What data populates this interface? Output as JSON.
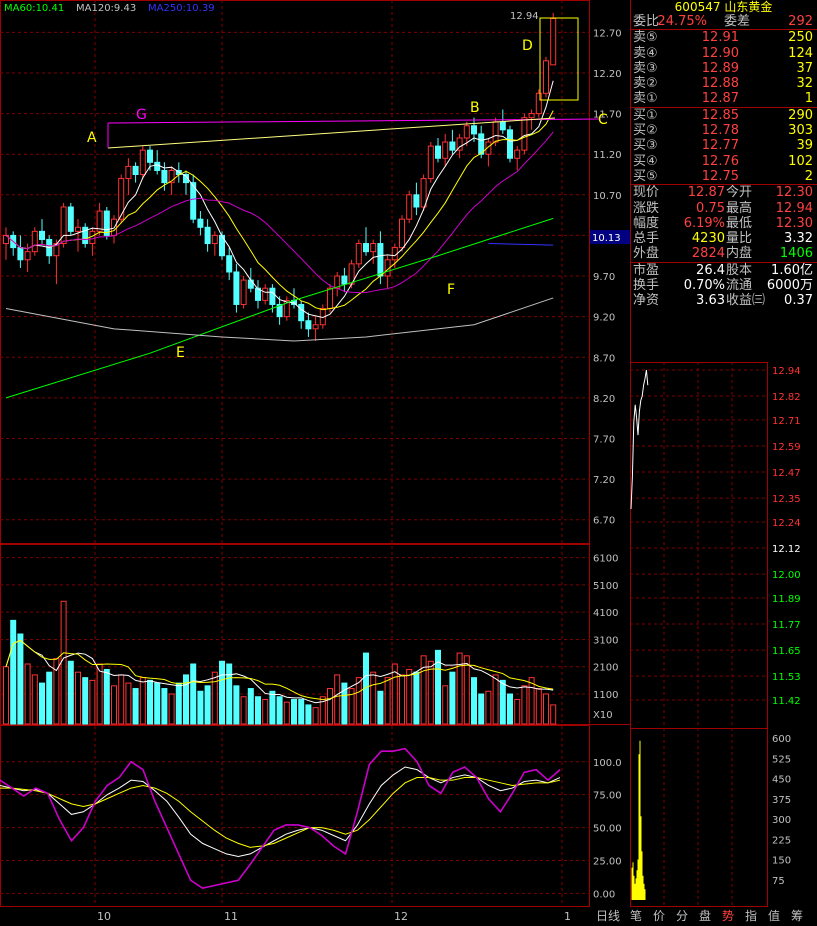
{
  "stock": {
    "code": "600547",
    "name": "山东黄金"
  },
  "ma_legend": [
    {
      "label": "MA60:10.41",
      "color": "#00ff00"
    },
    {
      "label": "MA120:9.43",
      "color": "#c0c0c0"
    },
    {
      "label": "MA250:10.39",
      "color": "#3333ff"
    }
  ],
  "annotations": {
    "A": "A",
    "B": "B",
    "C": "C",
    "D": "D",
    "E": "E",
    "F": "F",
    "G": "G",
    "peak": "12.94"
  },
  "current_price_tag": "10.13",
  "volume_unit": "X10",
  "quote": {
    "wei_bi_label": "委比",
    "wei_bi": "24.75%",
    "wei_cha_label": "委差",
    "wei_cha": "292",
    "sell": [
      {
        "label": "卖⑤",
        "price": "12.91",
        "vol": "250"
      },
      {
        "label": "卖④",
        "price": "12.90",
        "vol": "124"
      },
      {
        "label": "卖③",
        "price": "12.89",
        "vol": "37"
      },
      {
        "label": "卖②",
        "price": "12.88",
        "vol": "32"
      },
      {
        "label": "卖①",
        "price": "12.87",
        "vol": "1"
      }
    ],
    "buy": [
      {
        "label": "买①",
        "price": "12.85",
        "vol": "290"
      },
      {
        "label": "买②",
        "price": "12.78",
        "vol": "303"
      },
      {
        "label": "买③",
        "price": "12.77",
        "vol": "39"
      },
      {
        "label": "买④",
        "price": "12.76",
        "vol": "102"
      },
      {
        "label": "买⑤",
        "price": "12.75",
        "vol": "2"
      }
    ],
    "stats": [
      {
        "l1": "现价",
        "v1": "12.87",
        "c1": "#ff4040",
        "l2": "今开",
        "v2": "12.30",
        "c2": "#ff4040"
      },
      {
        "l1": "涨跌",
        "v1": "0.75",
        "c1": "#ff4040",
        "l2": "最高",
        "v2": "12.94",
        "c2": "#ff4040"
      },
      {
        "l1": "幅度",
        "v1": "6.19%",
        "c1": "#ff4040",
        "l2": "最低",
        "v2": "12.30",
        "c2": "#ff4040"
      },
      {
        "l1": "总手",
        "v1": "4230",
        "c1": "#ffff00",
        "l2": "量比",
        "v2": "3.32",
        "c2": "#ffffff"
      },
      {
        "l1": "外盘",
        "v1": "2824",
        "c1": "#ff4040",
        "l2": "内盘",
        "v2": "1406",
        "c2": "#00ff00"
      }
    ],
    "fundamentals": [
      {
        "l1": "市盈",
        "v1": "26.4",
        "l2": "股本",
        "v2": "1.60亿"
      },
      {
        "l1": "换手",
        "v1": "0.70%",
        "l2": "流通",
        "v2": "6000万"
      },
      {
        "l1": "净资",
        "v1": "3.63",
        "l2": "收益㈢",
        "v2": "0.37"
      }
    ]
  },
  "tabs": [
    "日线",
    "笔",
    "价",
    "分",
    "盘",
    "势",
    "指",
    "值",
    "筹"
  ],
  "chart_data": [
    {
      "type": "candlestick",
      "y_ticks": [
        "12.70",
        "12.20",
        "11.70",
        "11.20",
        "10.70",
        "10.20",
        "9.70",
        "9.20",
        "8.70",
        "8.20",
        "7.70",
        "7.20",
        "6.70"
      ],
      "ylim": [
        6.45,
        13.0
      ],
      "x_ticks": [
        "10",
        "11",
        "12",
        "1"
      ],
      "candles": [
        [
          10.1,
          10.3,
          9.9,
          10.2
        ],
        [
          10.2,
          10.25,
          9.95,
          10.05
        ],
        [
          10.05,
          10.2,
          9.8,
          9.9
        ],
        [
          9.9,
          10.1,
          9.75,
          10.0
        ],
        [
          10.0,
          10.3,
          9.95,
          10.25
        ],
        [
          10.25,
          10.4,
          10.1,
          10.15
        ],
        [
          10.15,
          10.2,
          9.85,
          9.95
        ],
        [
          9.95,
          10.15,
          9.6,
          10.1
        ],
        [
          10.1,
          10.6,
          10.05,
          10.55
        ],
        [
          10.55,
          10.6,
          10.2,
          10.25
        ],
        [
          10.25,
          10.4,
          10.0,
          10.3
        ],
        [
          10.3,
          10.35,
          10.05,
          10.1
        ],
        [
          10.1,
          10.3,
          9.95,
          10.25
        ],
        [
          10.25,
          10.6,
          10.2,
          10.5
        ],
        [
          10.5,
          10.55,
          10.15,
          10.2
        ],
        [
          10.2,
          10.45,
          10.1,
          10.4
        ],
        [
          10.4,
          10.95,
          10.35,
          10.9
        ],
        [
          10.9,
          11.15,
          10.7,
          11.05
        ],
        [
          11.05,
          11.1,
          10.85,
          10.95
        ],
        [
          10.95,
          11.3,
          10.9,
          11.25
        ],
        [
          11.25,
          11.3,
          11.0,
          11.1
        ],
        [
          11.1,
          11.25,
          10.95,
          11.0
        ],
        [
          11.0,
          11.1,
          10.75,
          10.85
        ],
        [
          10.85,
          11.05,
          10.7,
          11.0
        ],
        [
          11.0,
          11.1,
          10.85,
          10.95
        ],
        [
          10.95,
          11.0,
          10.7,
          10.85
        ],
        [
          10.85,
          10.95,
          10.35,
          10.4
        ],
        [
          10.4,
          10.5,
          10.2,
          10.3
        ],
        [
          10.3,
          10.4,
          10.0,
          10.1
        ],
        [
          10.1,
          10.25,
          9.95,
          10.2
        ],
        [
          10.2,
          10.25,
          9.9,
          9.95
        ],
        [
          9.95,
          10.05,
          9.65,
          9.75
        ],
        [
          9.75,
          9.85,
          9.25,
          9.35
        ],
        [
          9.35,
          9.7,
          9.3,
          9.65
        ],
        [
          9.65,
          9.8,
          9.5,
          9.55
        ],
        [
          9.55,
          9.65,
          9.3,
          9.4
        ],
        [
          9.4,
          9.6,
          9.35,
          9.55
        ],
        [
          9.55,
          9.6,
          9.25,
          9.35
        ],
        [
          9.35,
          9.45,
          9.1,
          9.2
        ],
        [
          9.2,
          9.45,
          9.15,
          9.4
        ],
        [
          9.4,
          9.55,
          9.3,
          9.35
        ],
        [
          9.35,
          9.4,
          9.05,
          9.15
        ],
        [
          9.15,
          9.25,
          8.95,
          9.05
        ],
        [
          9.05,
          9.2,
          8.9,
          9.1
        ],
        [
          9.1,
          9.35,
          9.05,
          9.3
        ],
        [
          9.3,
          9.6,
          9.25,
          9.55
        ],
        [
          9.55,
          9.75,
          9.45,
          9.7
        ],
        [
          9.7,
          9.8,
          9.5,
          9.6
        ],
        [
          9.6,
          9.9,
          9.55,
          9.85
        ],
        [
          9.85,
          10.15,
          9.8,
          10.1
        ],
        [
          10.1,
          10.3,
          9.95,
          10.0
        ],
        [
          10.0,
          10.15,
          9.85,
          10.1
        ],
        [
          10.1,
          10.25,
          9.6,
          9.7
        ],
        [
          9.7,
          9.95,
          9.55,
          9.9
        ],
        [
          9.9,
          10.1,
          9.8,
          10.05
        ],
        [
          10.05,
          10.45,
          10.0,
          10.4
        ],
        [
          10.4,
          10.75,
          10.35,
          10.7
        ],
        [
          10.7,
          10.85,
          10.45,
          10.55
        ],
        [
          10.55,
          10.95,
          10.5,
          10.9
        ],
        [
          10.9,
          11.35,
          10.85,
          11.3
        ],
        [
          11.3,
          11.4,
          11.1,
          11.15
        ],
        [
          11.15,
          11.45,
          11.05,
          11.35
        ],
        [
          11.35,
          11.5,
          11.2,
          11.25
        ],
        [
          11.25,
          11.45,
          11.15,
          11.4
        ],
        [
          11.4,
          11.6,
          11.3,
          11.55
        ],
        [
          11.55,
          11.65,
          11.35,
          11.45
        ],
        [
          11.45,
          11.55,
          11.15,
          11.2
        ],
        [
          11.2,
          11.4,
          11.05,
          11.35
        ],
        [
          11.35,
          11.65,
          11.3,
          11.6
        ],
        [
          11.6,
          11.75,
          11.45,
          11.5
        ],
        [
          11.5,
          11.55,
          11.1,
          11.15
        ],
        [
          11.15,
          11.3,
          11.0,
          11.25
        ],
        [
          11.25,
          11.7,
          11.2,
          11.65
        ],
        [
          11.65,
          11.75,
          11.5,
          11.7
        ],
        [
          11.7,
          12.0,
          11.65,
          11.95
        ],
        [
          11.95,
          12.4,
          11.9,
          12.35
        ],
        [
          12.3,
          12.94,
          12.3,
          12.87
        ]
      ],
      "series": [
        {
          "name": "MA60",
          "color": "#00ff00",
          "x": [
            0,
            20,
            40,
            60,
            76
          ],
          "values": [
            8.2,
            8.75,
            9.4,
            9.95,
            10.41
          ]
        },
        {
          "name": "MA120",
          "color": "#c0c0c0",
          "x": [
            0,
            15,
            30,
            40,
            50,
            65,
            76
          ],
          "values": [
            9.3,
            9.05,
            8.95,
            8.9,
            8.95,
            9.1,
            9.43
          ]
        },
        {
          "name": "MA250",
          "color": "#3333ff",
          "x": [
            67,
            76
          ],
          "values": [
            10.1,
            10.08
          ]
        }
      ]
    },
    {
      "type": "bar",
      "title": "volume",
      "y_ticks": [
        "6100",
        "5100",
        "4100",
        "3100",
        "2100",
        "1100"
      ],
      "unit": "X10",
      "values": [
        2100,
        3800,
        3300,
        2200,
        1800,
        1500,
        1900,
        2400,
        4500,
        2300,
        1900,
        1700,
        1600,
        2200,
        2000,
        1400,
        1800,
        1500,
        1300,
        1700,
        1600,
        1500,
        1300,
        1100,
        1500,
        1800,
        2200,
        1200,
        1400,
        1900,
        2300,
        2200,
        1400,
        1000,
        1300,
        1000,
        900,
        1200,
        1000,
        800,
        900,
        900,
        700,
        600,
        1000,
        1300,
        1800,
        1500,
        1300,
        1700,
        2600,
        1900,
        1200,
        1700,
        2200,
        1800,
        2000,
        1900,
        2500,
        2300,
        2700,
        1400,
        1900,
        2600,
        2500,
        1700,
        1100,
        1200,
        1800,
        1600,
        1100,
        900,
        1400,
        1700,
        1300,
        1100,
        700
      ]
    },
    {
      "type": "line",
      "title": "KD",
      "y_ticks": [
        "100.0",
        "75.00",
        "50.00",
        "25.00",
        "0.00"
      ],
      "ylim": [
        -5,
        115
      ],
      "series": [
        {
          "name": "K",
          "color": "#ffffff",
          "values": [
            82,
            80,
            78,
            79,
            76,
            68,
            60,
            62,
            68,
            75,
            80,
            86,
            85,
            78,
            70,
            58,
            45,
            38,
            34,
            30,
            28,
            30,
            35,
            40,
            45,
            48,
            50,
            48,
            44,
            40,
            52,
            68,
            82,
            90,
            96,
            94,
            88,
            84,
            88,
            90,
            88,
            82,
            78,
            80,
            85,
            86,
            84,
            88
          ]
        },
        {
          "name": "D",
          "color": "#ffff00",
          "values": [
            80,
            80,
            79,
            78,
            76,
            72,
            68,
            66,
            68,
            72,
            76,
            80,
            82,
            80,
            76,
            70,
            62,
            55,
            48,
            42,
            38,
            35,
            36,
            38,
            42,
            46,
            50,
            50,
            48,
            45,
            48,
            56,
            66,
            76,
            84,
            88,
            88,
            86,
            86,
            88,
            88,
            86,
            84,
            82,
            83,
            84,
            84,
            86
          ]
        },
        {
          "name": "J",
          "color": "#cc00cc",
          "values": [
            86,
            80,
            74,
            80,
            76,
            56,
            40,
            50,
            70,
            82,
            88,
            100,
            94,
            70,
            50,
            30,
            10,
            4,
            6,
            8,
            10,
            22,
            35,
            48,
            52,
            52,
            50,
            44,
            36,
            30,
            62,
            98,
            108,
            108,
            110,
            100,
            82,
            76,
            92,
            96,
            88,
            72,
            62,
            76,
            92,
            94,
            86,
            94
          ]
        }
      ]
    },
    {
      "type": "line",
      "title": "intraday",
      "y_ticks": [
        "12.94",
        "12.82",
        "12.71",
        "12.59",
        "12.47",
        "12.35",
        "12.24",
        "12.12",
        "12.00",
        "11.89",
        "11.77",
        "11.65",
        "11.53",
        "11.42"
      ],
      "values": [
        12.3,
        12.45,
        12.7,
        12.78,
        12.72,
        12.64,
        12.75,
        12.8,
        12.82,
        12.87,
        12.9,
        12.94,
        12.87
      ]
    },
    {
      "type": "bar",
      "title": "intraday volume",
      "y_ticks": [
        "600",
        "525",
        "450",
        "375",
        "300",
        "225",
        "150",
        "75"
      ],
      "values": [
        120,
        140,
        90,
        60,
        80,
        110,
        150,
        540,
        590,
        310,
        180,
        90,
        60,
        40
      ]
    }
  ]
}
